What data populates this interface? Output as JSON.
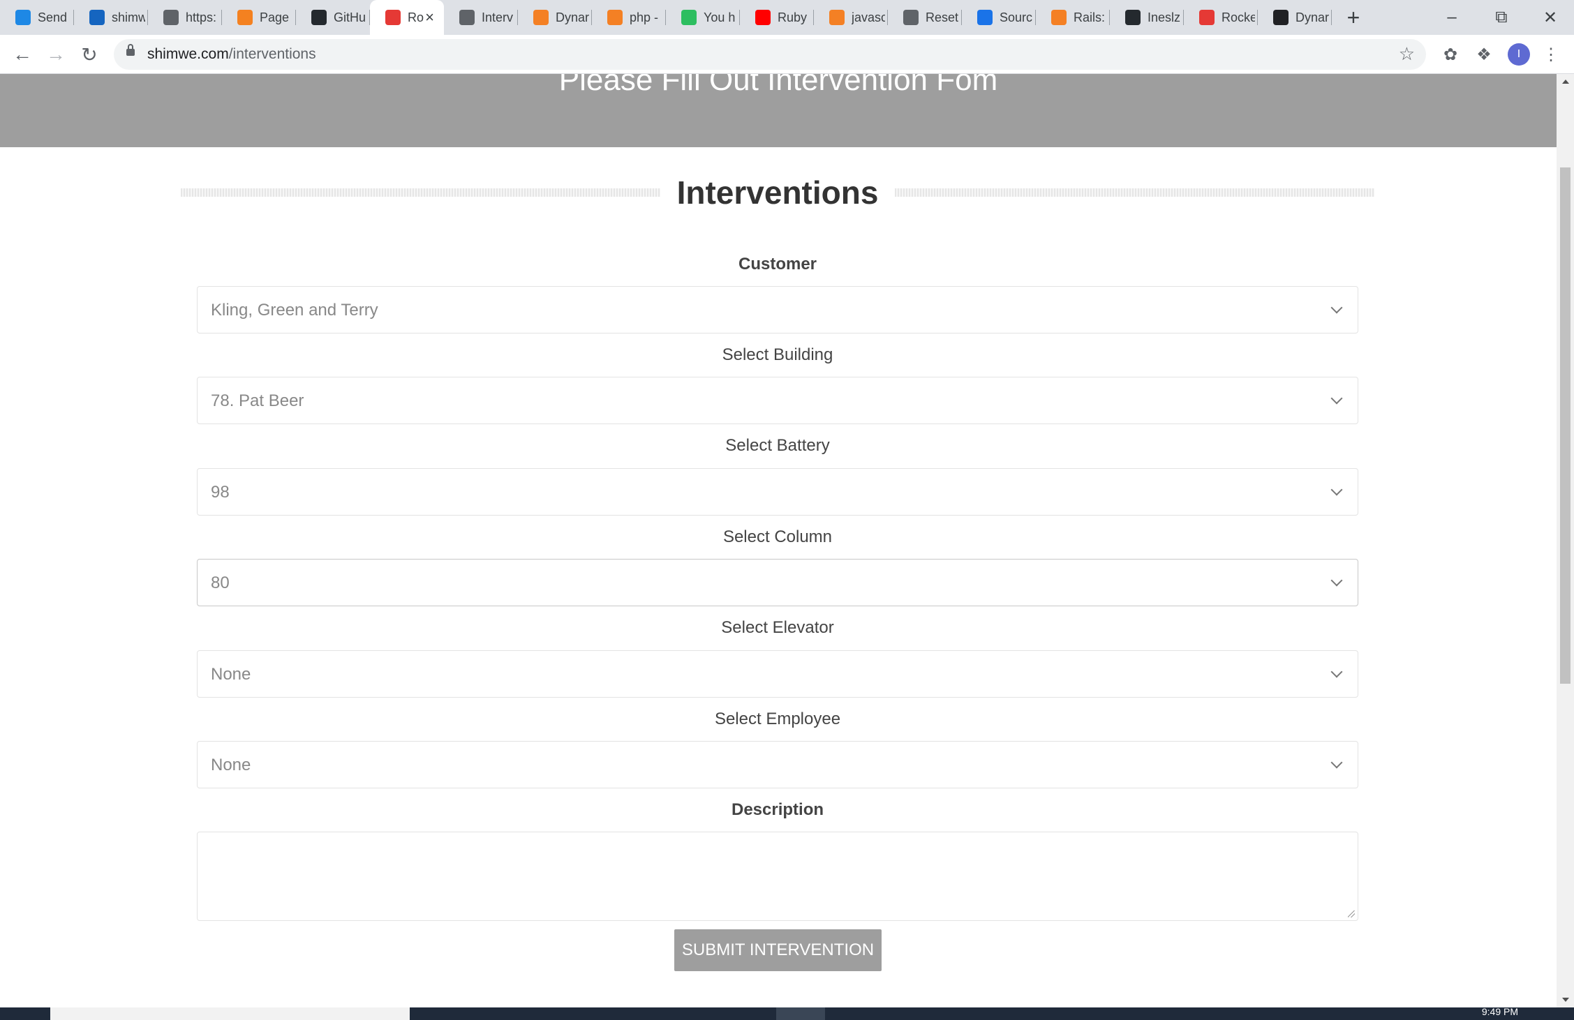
{
  "browser": {
    "tabs": [
      {
        "label": "Send",
        "color": "#1e88e5",
        "icon": "windows-logo-icon"
      },
      {
        "label": "shimw",
        "color": "#1565c0",
        "icon": "azure-icon"
      },
      {
        "label": "https:",
        "color": "#5f6368",
        "icon": "globe-icon"
      },
      {
        "label": "Page",
        "color": "#f48120",
        "icon": "cloudflare-icon"
      },
      {
        "label": "GitHu",
        "color": "#24292e",
        "icon": "github-icon"
      },
      {
        "label": "Ro",
        "color": "#e53935",
        "icon": "rocket-icon",
        "active": true
      },
      {
        "label": "Interv",
        "color": "#5f6368",
        "icon": "globe-icon"
      },
      {
        "label": "Dynar",
        "color": "#f48024",
        "icon": "stackoverflow-icon"
      },
      {
        "label": "php -",
        "color": "#f48024",
        "icon": "stackoverflow-icon"
      },
      {
        "label": "You h",
        "color": "#2dbe60",
        "icon": "evernote-icon"
      },
      {
        "label": "Ruby",
        "color": "#ff0000",
        "icon": "youtube-icon"
      },
      {
        "label": "javasc",
        "color": "#f48024",
        "icon": "stackoverflow-icon"
      },
      {
        "label": "Reset",
        "color": "#5f6368",
        "icon": "globe-icon"
      },
      {
        "label": "Sourc",
        "color": "#1a73e8",
        "icon": "map-pin-icon"
      },
      {
        "label": "Rails:",
        "color": "#f48024",
        "icon": "stackoverflow-icon"
      },
      {
        "label": "Ineslz",
        "color": "#24292e",
        "icon": "github-icon"
      },
      {
        "label": "Rocke",
        "color": "#e53935",
        "icon": "rocket-icon"
      },
      {
        "label": "Dynar",
        "color": "#202124",
        "icon": "hashbang-icon"
      }
    ],
    "url_domain": "shimwe.com",
    "url_path": "/interventions",
    "avatar_letter": "I"
  },
  "page": {
    "hero_title": "Please Fill Out Intervention Fom",
    "heading": "Interventions",
    "customer_label": "Customer",
    "customer_value": "Kling, Green and Terry",
    "building_label": "Select Building",
    "building_value": "78. Pat Beer",
    "battery_label": "Select Battery",
    "battery_value": "98",
    "column_label": "Select Column",
    "column_value": "80",
    "elevator_label": "Select Elevator",
    "elevator_value": "None",
    "employee_label": "Select Employee",
    "employee_value": "None",
    "description_label": "Description",
    "submit_label": "SUBMIT INTERVENTION"
  },
  "taskbar": {
    "time": "9:49 PM"
  }
}
